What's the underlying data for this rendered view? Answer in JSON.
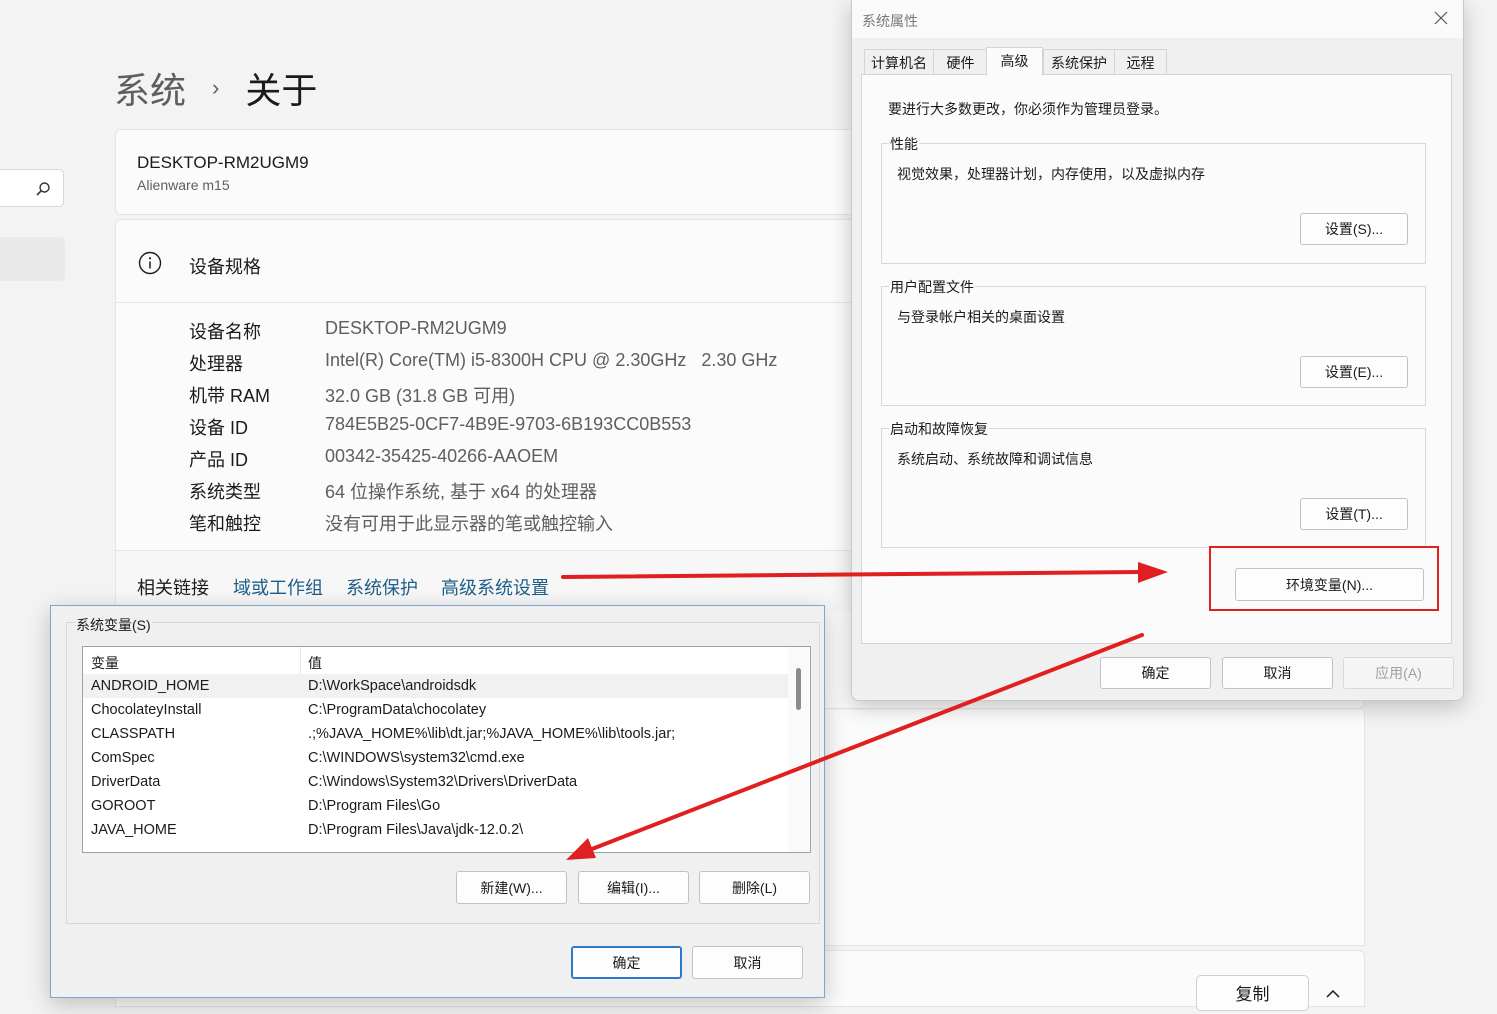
{
  "settings": {
    "breadcrumb": {
      "parent": "系统",
      "separator": "›",
      "current": "关于"
    },
    "device": {
      "name": "DESKTOP-RM2UGM9",
      "model": "Alienware m15"
    },
    "specs": {
      "title": "设备规格",
      "rows": [
        {
          "label": "设备名称",
          "value": "DESKTOP-RM2UGM9"
        },
        {
          "label": "处理器",
          "value": "Intel(R) Core(TM) i5-8300H CPU @ 2.30GHz   2.30 GHz"
        },
        {
          "label": "机带 RAM",
          "value": "32.0 GB (31.8 GB 可用)"
        },
        {
          "label": "设备 ID",
          "value": "784E5B25-0CF7-4B9E-9703-6B193CC0B553"
        },
        {
          "label": "产品 ID",
          "value": "00342-35425-40266-AAOEM"
        },
        {
          "label": "系统类型",
          "value": "64 位操作系统, 基于 x64 的处理器"
        },
        {
          "label": "笔和触控",
          "value": "没有可用于此显示器的笔或触控输入"
        }
      ]
    },
    "related": {
      "label": "相关链接",
      "links": [
        "域或工作组",
        "系统保护",
        "高级系统设置"
      ]
    },
    "copy_button": "复制"
  },
  "system_properties": {
    "title": "系统属性",
    "tabs": [
      "计算机名",
      "硬件",
      "高级",
      "系统保护",
      "远程"
    ],
    "active_tab": "高级",
    "admin_note": "要进行大多数更改，你必须作为管理员登录。",
    "groups": [
      {
        "title": "性能",
        "description": "视觉效果，处理器计划，内存使用，以及虚拟内存",
        "button": "设置(S)..."
      },
      {
        "title": "用户配置文件",
        "description": "与登录帐户相关的桌面设置",
        "button": "设置(E)..."
      },
      {
        "title": "启动和故障恢复",
        "description": "系统启动、系统故障和调试信息",
        "button": "设置(T)..."
      }
    ],
    "env_button": "环境变量(N)...",
    "ok": "确定",
    "cancel": "取消",
    "apply": "应用(A)"
  },
  "env_dialog": {
    "system_vars_title": "系统变量(S)",
    "columns": [
      "变量",
      "值"
    ],
    "rows": [
      {
        "name": "ANDROID_HOME",
        "value": "D:\\WorkSpace\\androidsdk"
      },
      {
        "name": "ChocolateyInstall",
        "value": "C:\\ProgramData\\chocolatey"
      },
      {
        "name": "CLASSPATH",
        "value": ".;%JAVA_HOME%\\lib\\dt.jar;%JAVA_HOME%\\lib\\tools.jar;"
      },
      {
        "name": "ComSpec",
        "value": "C:\\WINDOWS\\system32\\cmd.exe"
      },
      {
        "name": "DriverData",
        "value": "C:\\Windows\\System32\\Drivers\\DriverData"
      },
      {
        "name": "GOROOT",
        "value": "D:\\Program Files\\Go"
      },
      {
        "name": "JAVA_HOME",
        "value": "D:\\Program Files\\Java\\jdk-12.0.2\\"
      }
    ],
    "new_button": "新建(W)...",
    "edit_button": "编辑(I)...",
    "delete_button": "删除(L)",
    "ok": "确定",
    "cancel": "取消"
  },
  "colors": {
    "link": "#1d5f89",
    "annotation_red": "#e02020",
    "accent": "#2f77c9"
  }
}
